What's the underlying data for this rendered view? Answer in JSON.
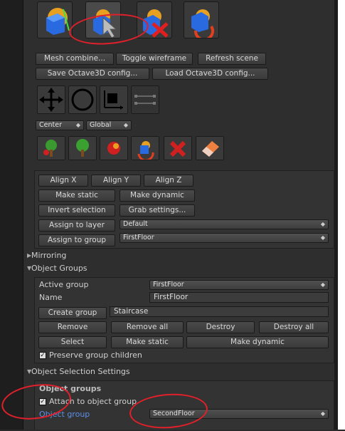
{
  "toolbar_row1": {
    "mesh_combine": "Mesh combine...",
    "toggle_wireframe": "Toggle wireframe",
    "refresh_scene": "Refresh scene"
  },
  "toolbar_row2": {
    "save_config": "Save Octave3D config...",
    "load_config": "Load Octave3D config..."
  },
  "pivot": {
    "value": "Center"
  },
  "space": {
    "value": "Global"
  },
  "align": {
    "x": "Align X",
    "y": "Align Y",
    "z": "Align Z"
  },
  "static_dynamic": {
    "make_static": "Make static",
    "make_dynamic": "Make dynamic"
  },
  "selection": {
    "invert": "Invert selection",
    "grab_settings": "Grab settings..."
  },
  "assign_layer": {
    "label": "Assign to layer",
    "value": "Default"
  },
  "assign_group": {
    "label": "Assign to group",
    "value": "FirstFloor"
  },
  "sections": {
    "mirroring": "Mirroring",
    "object_groups": "Object Groups",
    "selection_settings": "Object Selection Settings"
  },
  "object_groups": {
    "active_group_label": "Active group",
    "active_group_value": "FirstFloor",
    "name_label": "Name",
    "name_value": "FirstFloor",
    "create_group": "Create group",
    "create_group_value": "Staircase",
    "remove": "Remove",
    "remove_all": "Remove all",
    "destroy": "Destroy",
    "destroy_all": "Destroy all",
    "select": "Select",
    "make_static": "Make static",
    "make_dynamic": "Make dynamic",
    "preserve_children": "Preserve group children"
  },
  "selection_settings": {
    "heading": "Object groups",
    "attach_label": "Attach to object group",
    "object_group_label": "Object group",
    "object_group_value": "SecondFloor"
  },
  "colors": {
    "accent_link": "#5b8fe6",
    "annotation": "#e0202a"
  }
}
